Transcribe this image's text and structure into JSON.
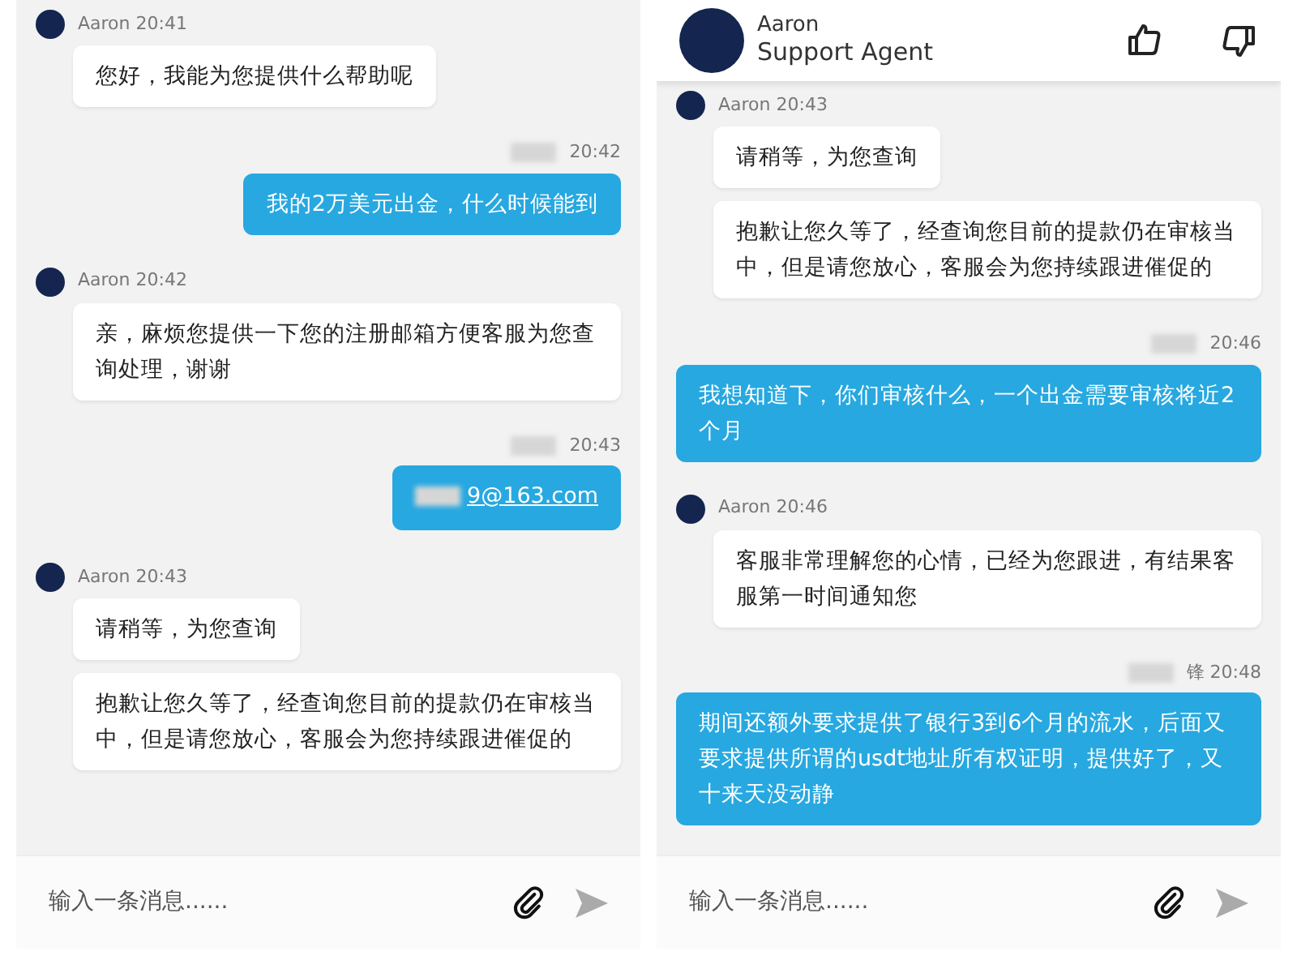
{
  "panels": [
    {
      "messages": [
        {
          "kind": "agent-meta",
          "label": "Aaron 20:41"
        },
        {
          "kind": "agent-bubble",
          "text": "您好，我能为您提供什么帮助呢"
        },
        {
          "kind": "user-meta",
          "redacted": true,
          "label": "20:42"
        },
        {
          "kind": "user-bubble",
          "text": "我的2万美元出金，什么时候能到"
        },
        {
          "kind": "agent-meta",
          "label": "Aaron 20:42"
        },
        {
          "kind": "agent-bubble",
          "text": "亲，麻烦您提供一下您的注册邮箱方便客服为您查询处理，谢谢"
        },
        {
          "kind": "user-meta",
          "redacted": true,
          "label": "20:43"
        },
        {
          "kind": "user-bubble",
          "link": true,
          "redacted": true,
          "text": "9@163.com"
        },
        {
          "kind": "agent-meta",
          "label": "Aaron 20:43"
        },
        {
          "kind": "agent-bubble",
          "text": "请稍等，为您查询"
        },
        {
          "kind": "agent-bubble",
          "text": "抱歉让您久等了，经查询您目前的提款仍在审核当中，但是请您放心，客服会为您持续跟进催促的"
        }
      ],
      "composer": {
        "placeholder": "输入一条消息......"
      }
    },
    {
      "header": {
        "name": "Aaron",
        "role": "Support Agent"
      },
      "messages": [
        {
          "kind": "agent-meta",
          "label": "Aaron 20:43"
        },
        {
          "kind": "agent-bubble",
          "text": "请稍等，为您查询"
        },
        {
          "kind": "agent-bubble",
          "text": "抱歉让您久等了，经查询您目前的提款仍在审核当中，但是请您放心，客服会为您持续跟进催促的"
        },
        {
          "kind": "user-meta",
          "redacted": true,
          "label": "20:46"
        },
        {
          "kind": "user-bubble",
          "text": "我想知道下，你们审核什么，一个出金需要审核将近2个月"
        },
        {
          "kind": "agent-meta",
          "label": "Aaron 20:46"
        },
        {
          "kind": "agent-bubble",
          "text": "客服非常理解您的心情，已经为您跟进，有结果客服第一时间通知您"
        },
        {
          "kind": "user-meta",
          "redacted": true,
          "label": "锋 20:48"
        },
        {
          "kind": "user-bubble",
          "text": "期间还额外要求提供了银行3到6个月的流水，后面又要求提供所谓的usdt地址所有权证明，提供好了，又十来天没动静"
        }
      ],
      "composer": {
        "placeholder": "输入一条消息......"
      }
    }
  ]
}
